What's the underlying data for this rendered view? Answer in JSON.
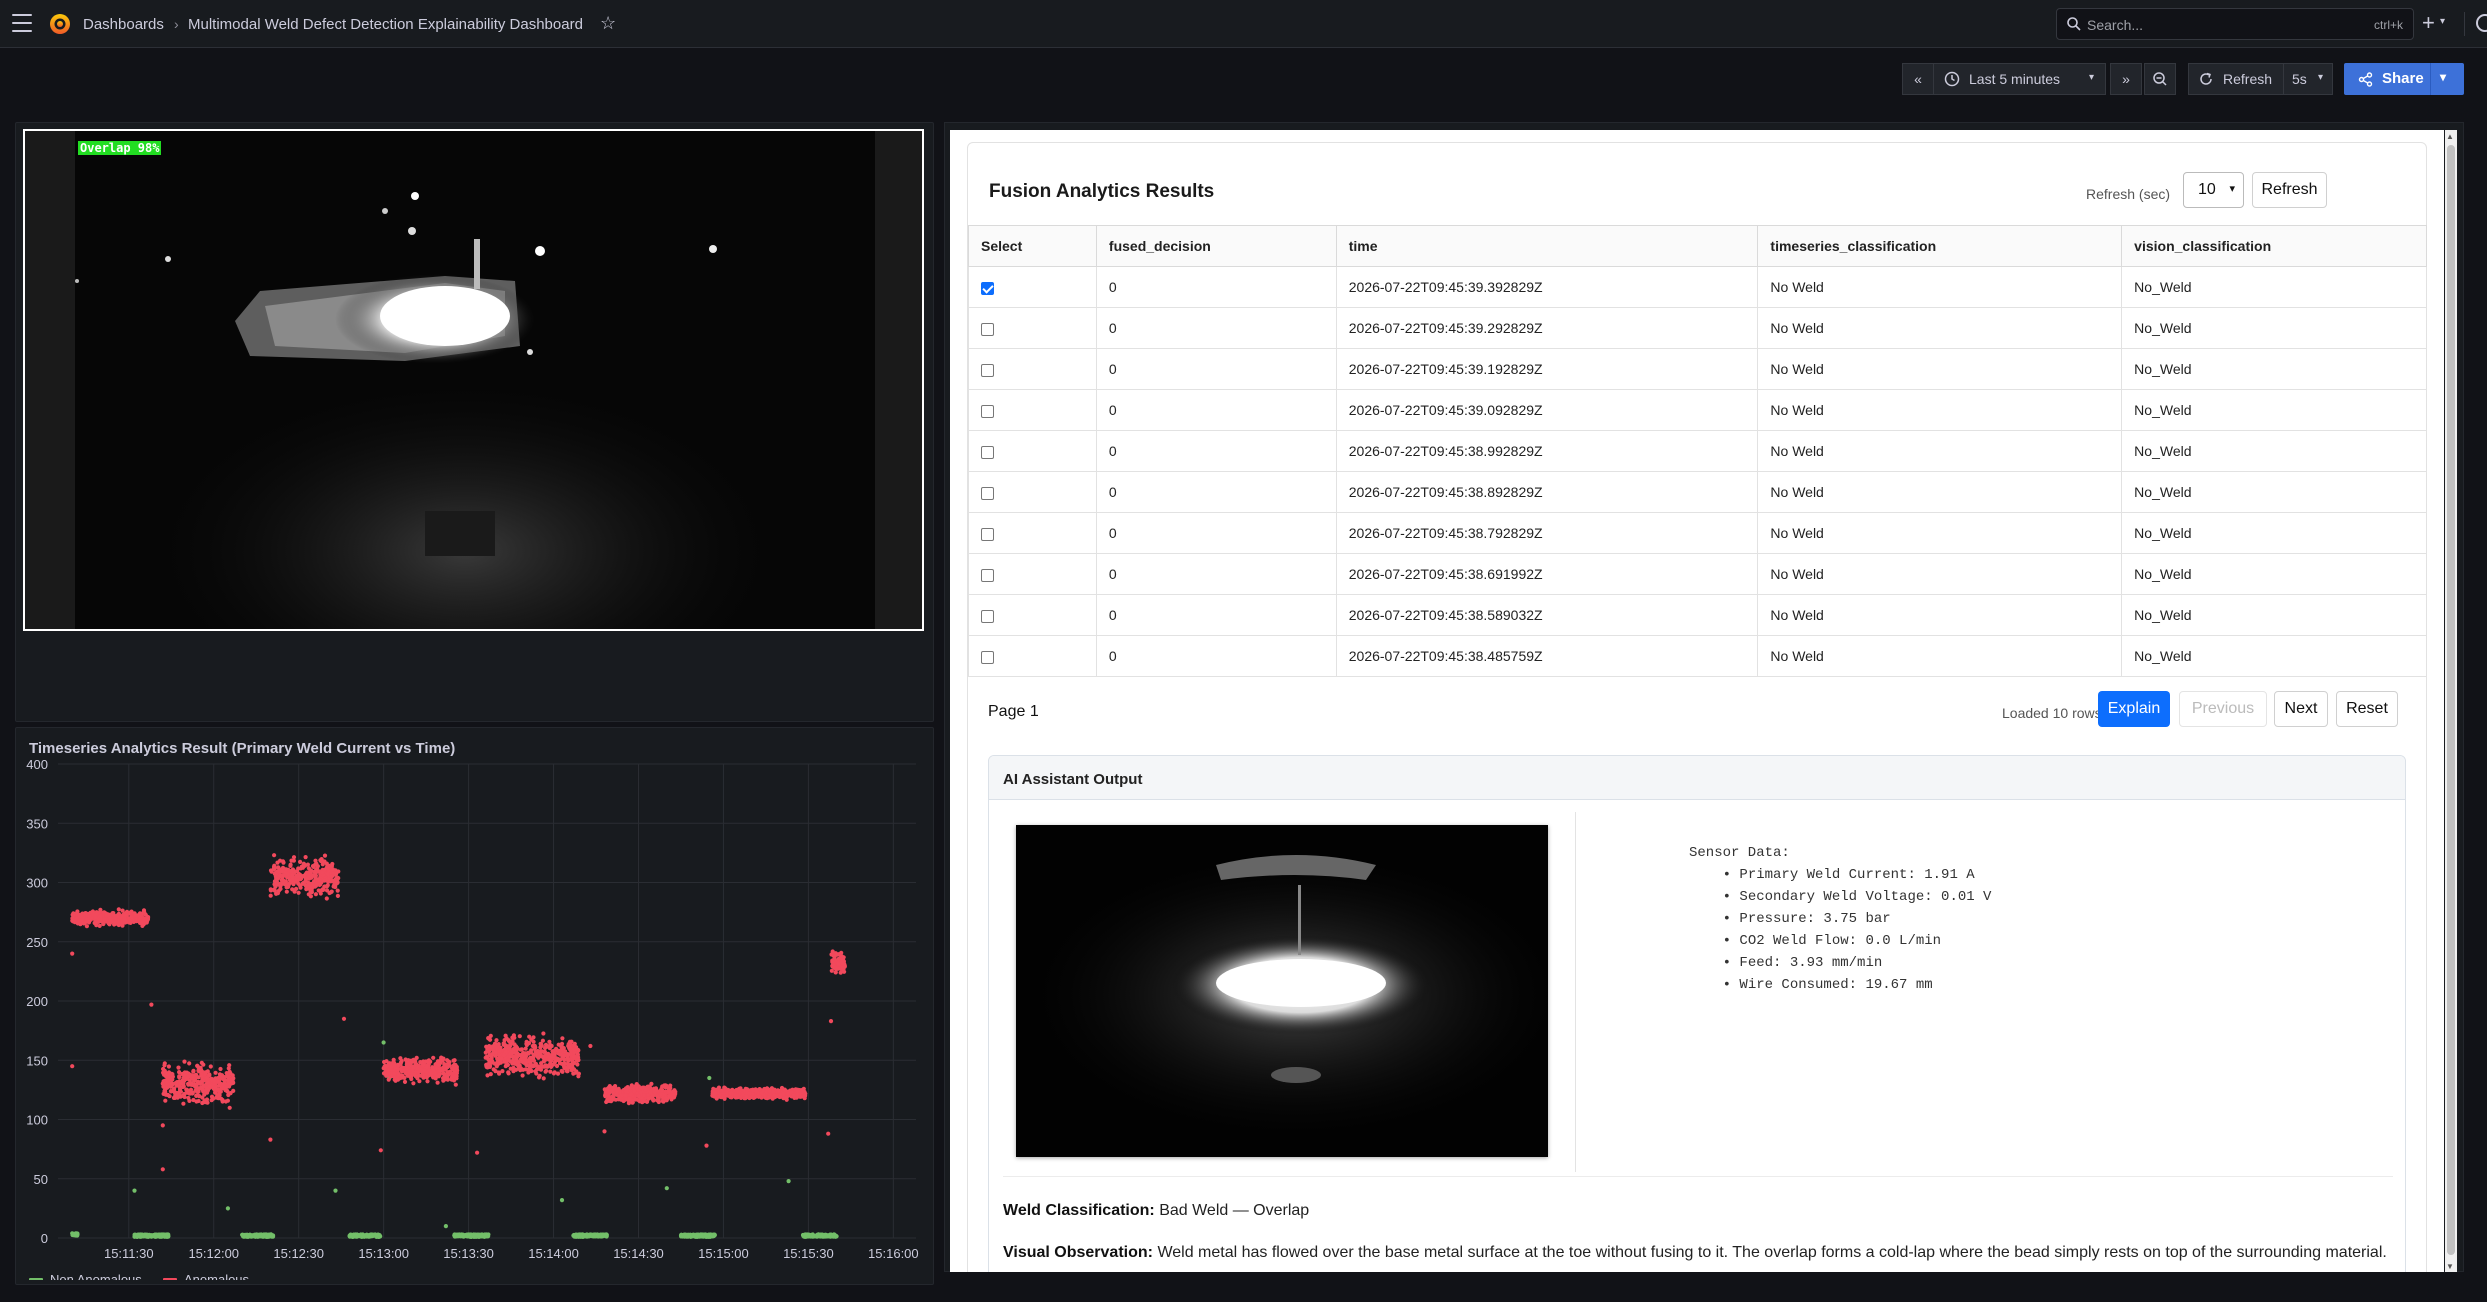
{
  "topbar": {
    "breadcrumb_home": "Dashboards",
    "breadcrumb_sep": "›",
    "dashboard_title": "Multimodal Weld Defect Detection Explainability Dashboard",
    "search_placeholder": "Search...",
    "search_shortcut": "ctrl+k"
  },
  "toolbar": {
    "time_range": "Last 5 minutes",
    "refresh_label": "Refresh",
    "refresh_interval": "5s",
    "share_label": "Share"
  },
  "camera_panel": {
    "overlay_label": "Overlap 98%"
  },
  "timeseries_panel": {
    "title": "Timeseries Analytics Result (Primary Weld Current vs Time)"
  },
  "chart_data": {
    "type": "scatter",
    "title": "Timeseries Analytics Result (Primary Weld Current vs Time)",
    "xlabel": "",
    "ylabel": "",
    "ylim": [
      0,
      400
    ],
    "y_ticks": [
      "0",
      "50",
      "100",
      "150",
      "200",
      "250",
      "300",
      "350",
      "400"
    ],
    "x_ticks": [
      "15:11:30",
      "15:12:00",
      "15:12:30",
      "15:13:00",
      "15:13:30",
      "15:14:00",
      "15:14:30",
      "15:15:00",
      "15:15:30",
      "15:16:00"
    ],
    "grid": true,
    "legend_placement": "bottom-left",
    "series": [
      {
        "name": "Non Anomalous",
        "color": "#73bf69",
        "clusters": [
          {
            "t_start": "15:11:10",
            "t_end": "15:11:12",
            "y": 2
          },
          {
            "t_start": "15:11:32",
            "t_end": "15:11:44",
            "y": 1
          },
          {
            "t_start": "15:12:10",
            "t_end": "15:12:21",
            "y": 1
          },
          {
            "t_start": "15:12:48",
            "t_end": "15:12:59",
            "y": 1
          },
          {
            "t_start": "15:13:25",
            "t_end": "15:13:37",
            "y": 1
          },
          {
            "t_start": "15:14:07",
            "t_end": "15:14:19",
            "y": 1
          },
          {
            "t_start": "15:14:45",
            "t_end": "15:14:57",
            "y": 1
          },
          {
            "t_start": "15:15:28",
            "t_end": "15:15:40",
            "y": 1
          }
        ],
        "outliers": [
          {
            "t": "15:11:32",
            "y": 40
          },
          {
            "t": "15:12:05",
            "y": 25
          },
          {
            "t": "15:12:43",
            "y": 40
          },
          {
            "t": "15:13:22",
            "y": 10
          },
          {
            "t": "15:14:03",
            "y": 32
          },
          {
            "t": "15:14:40",
            "y": 42
          },
          {
            "t": "15:15:23",
            "y": 48
          },
          {
            "t": "15:13:00",
            "y": 165
          },
          {
            "t": "15:13:02",
            "y": 135
          },
          {
            "t": "15:14:55",
            "y": 135
          }
        ]
      },
      {
        "name": "Anomalous",
        "color": "#f2495c",
        "clusters": [
          {
            "t_start": "15:11:10",
            "t_end": "15:11:37",
            "y_center": 270,
            "y_spread": 8
          },
          {
            "t_start": "15:11:42",
            "t_end": "15:12:07",
            "y_center": 130,
            "y_spread": 22
          },
          {
            "t_start": "15:12:20",
            "t_end": "15:12:44",
            "y_center": 305,
            "y_spread": 22
          },
          {
            "t_start": "15:13:00",
            "t_end": "15:13:26",
            "y_center": 142,
            "y_spread": 14
          },
          {
            "t_start": "15:13:36",
            "t_end": "15:14:09",
            "y_center": 153,
            "y_spread": 22
          },
          {
            "t_start": "15:14:18",
            "t_end": "15:14:43",
            "y_center": 122,
            "y_spread": 10
          },
          {
            "t_start": "15:14:56",
            "t_end": "15:15:29",
            "y_center": 122,
            "y_spread": 6
          },
          {
            "t_start": "15:15:38",
            "t_end": "15:15:43",
            "y_center": 232,
            "y_spread": 12
          }
        ],
        "outliers": [
          {
            "t": "15:11:10",
            "y": 145
          },
          {
            "t": "15:11:10",
            "y": 240
          },
          {
            "t": "15:11:38",
            "y": 197
          },
          {
            "t": "15:11:42",
            "y": 58
          },
          {
            "t": "15:11:42",
            "y": 95
          },
          {
            "t": "15:12:20",
            "y": 83
          },
          {
            "t": "15:12:46",
            "y": 185
          },
          {
            "t": "15:12:59",
            "y": 74
          },
          {
            "t": "15:13:33",
            "y": 72
          },
          {
            "t": "15:14:13",
            "y": 162
          },
          {
            "t": "15:14:18",
            "y": 90
          },
          {
            "t": "15:14:54",
            "y": 78
          },
          {
            "t": "15:15:37",
            "y": 88
          },
          {
            "t": "15:15:38",
            "y": 183
          }
        ]
      }
    ]
  },
  "fusion": {
    "title": "Fusion Analytics Results",
    "refresh_label": "Refresh (sec)",
    "refresh_value": "10",
    "refresh_button": "Refresh",
    "columns": [
      "Select",
      "fused_decision",
      "time",
      "timeseries_classification",
      "vision_classification"
    ],
    "rows": [
      {
        "checked": true,
        "fused_decision": "0",
        "time": "2026-07-22T09:45:39.392829Z",
        "timeseries_classification": "No Weld",
        "vision_classification": "No_Weld"
      },
      {
        "checked": false,
        "fused_decision": "0",
        "time": "2026-07-22T09:45:39.292829Z",
        "timeseries_classification": "No Weld",
        "vision_classification": "No_Weld"
      },
      {
        "checked": false,
        "fused_decision": "0",
        "time": "2026-07-22T09:45:39.192829Z",
        "timeseries_classification": "No Weld",
        "vision_classification": "No_Weld"
      },
      {
        "checked": false,
        "fused_decision": "0",
        "time": "2026-07-22T09:45:39.092829Z",
        "timeseries_classification": "No Weld",
        "vision_classification": "No_Weld"
      },
      {
        "checked": false,
        "fused_decision": "0",
        "time": "2026-07-22T09:45:38.992829Z",
        "timeseries_classification": "No Weld",
        "vision_classification": "No_Weld"
      },
      {
        "checked": false,
        "fused_decision": "0",
        "time": "2026-07-22T09:45:38.892829Z",
        "timeseries_classification": "No Weld",
        "vision_classification": "No_Weld"
      },
      {
        "checked": false,
        "fused_decision": "0",
        "time": "2026-07-22T09:45:38.792829Z",
        "timeseries_classification": "No Weld",
        "vision_classification": "No_Weld"
      },
      {
        "checked": false,
        "fused_decision": "0",
        "time": "2026-07-22T09:45:38.691992Z",
        "timeseries_classification": "No Weld",
        "vision_classification": "No_Weld"
      },
      {
        "checked": false,
        "fused_decision": "0",
        "time": "2026-07-22T09:45:38.589032Z",
        "timeseries_classification": "No Weld",
        "vision_classification": "No_Weld"
      },
      {
        "checked": false,
        "fused_decision": "0",
        "time": "2026-07-22T09:45:38.485759Z",
        "timeseries_classification": "No Weld",
        "vision_classification": "No_Weld"
      }
    ],
    "page_label": "Page 1",
    "loaded_label": "Loaded 10 rows.",
    "explain_button": "Explain",
    "previous_button": "Previous",
    "next_button": "Next",
    "reset_button": "Reset"
  },
  "ai_output": {
    "title": "AI Assistant Output",
    "sensor_header": "Sensor Data:",
    "sensor_items": [
      "Primary Weld Current: 1.91 A",
      "Secondary Weld Voltage: 0.01 V",
      "Pressure: 3.75 bar",
      "CO2 Weld Flow: 0.0 L/min",
      "Feed: 3.93 mm/min",
      "Wire Consumed: 19.67 mm"
    ],
    "classification_label": "Weld Classification:",
    "classification_value": "Bad Weld — Overlap",
    "observation_label": "Visual Observation:",
    "observation_value": "Weld metal has flowed over the base metal surface at the toe without fusing to it. The overlap forms a cold-lap where the bead simply rests on top of the surrounding material."
  },
  "colors": {
    "accent_blue": "#3d71d9",
    "button_blue": "#0d6efd",
    "anomalous": "#f2495c",
    "non_anomalous": "#73bf69",
    "panel_bg": "#181b1f"
  }
}
